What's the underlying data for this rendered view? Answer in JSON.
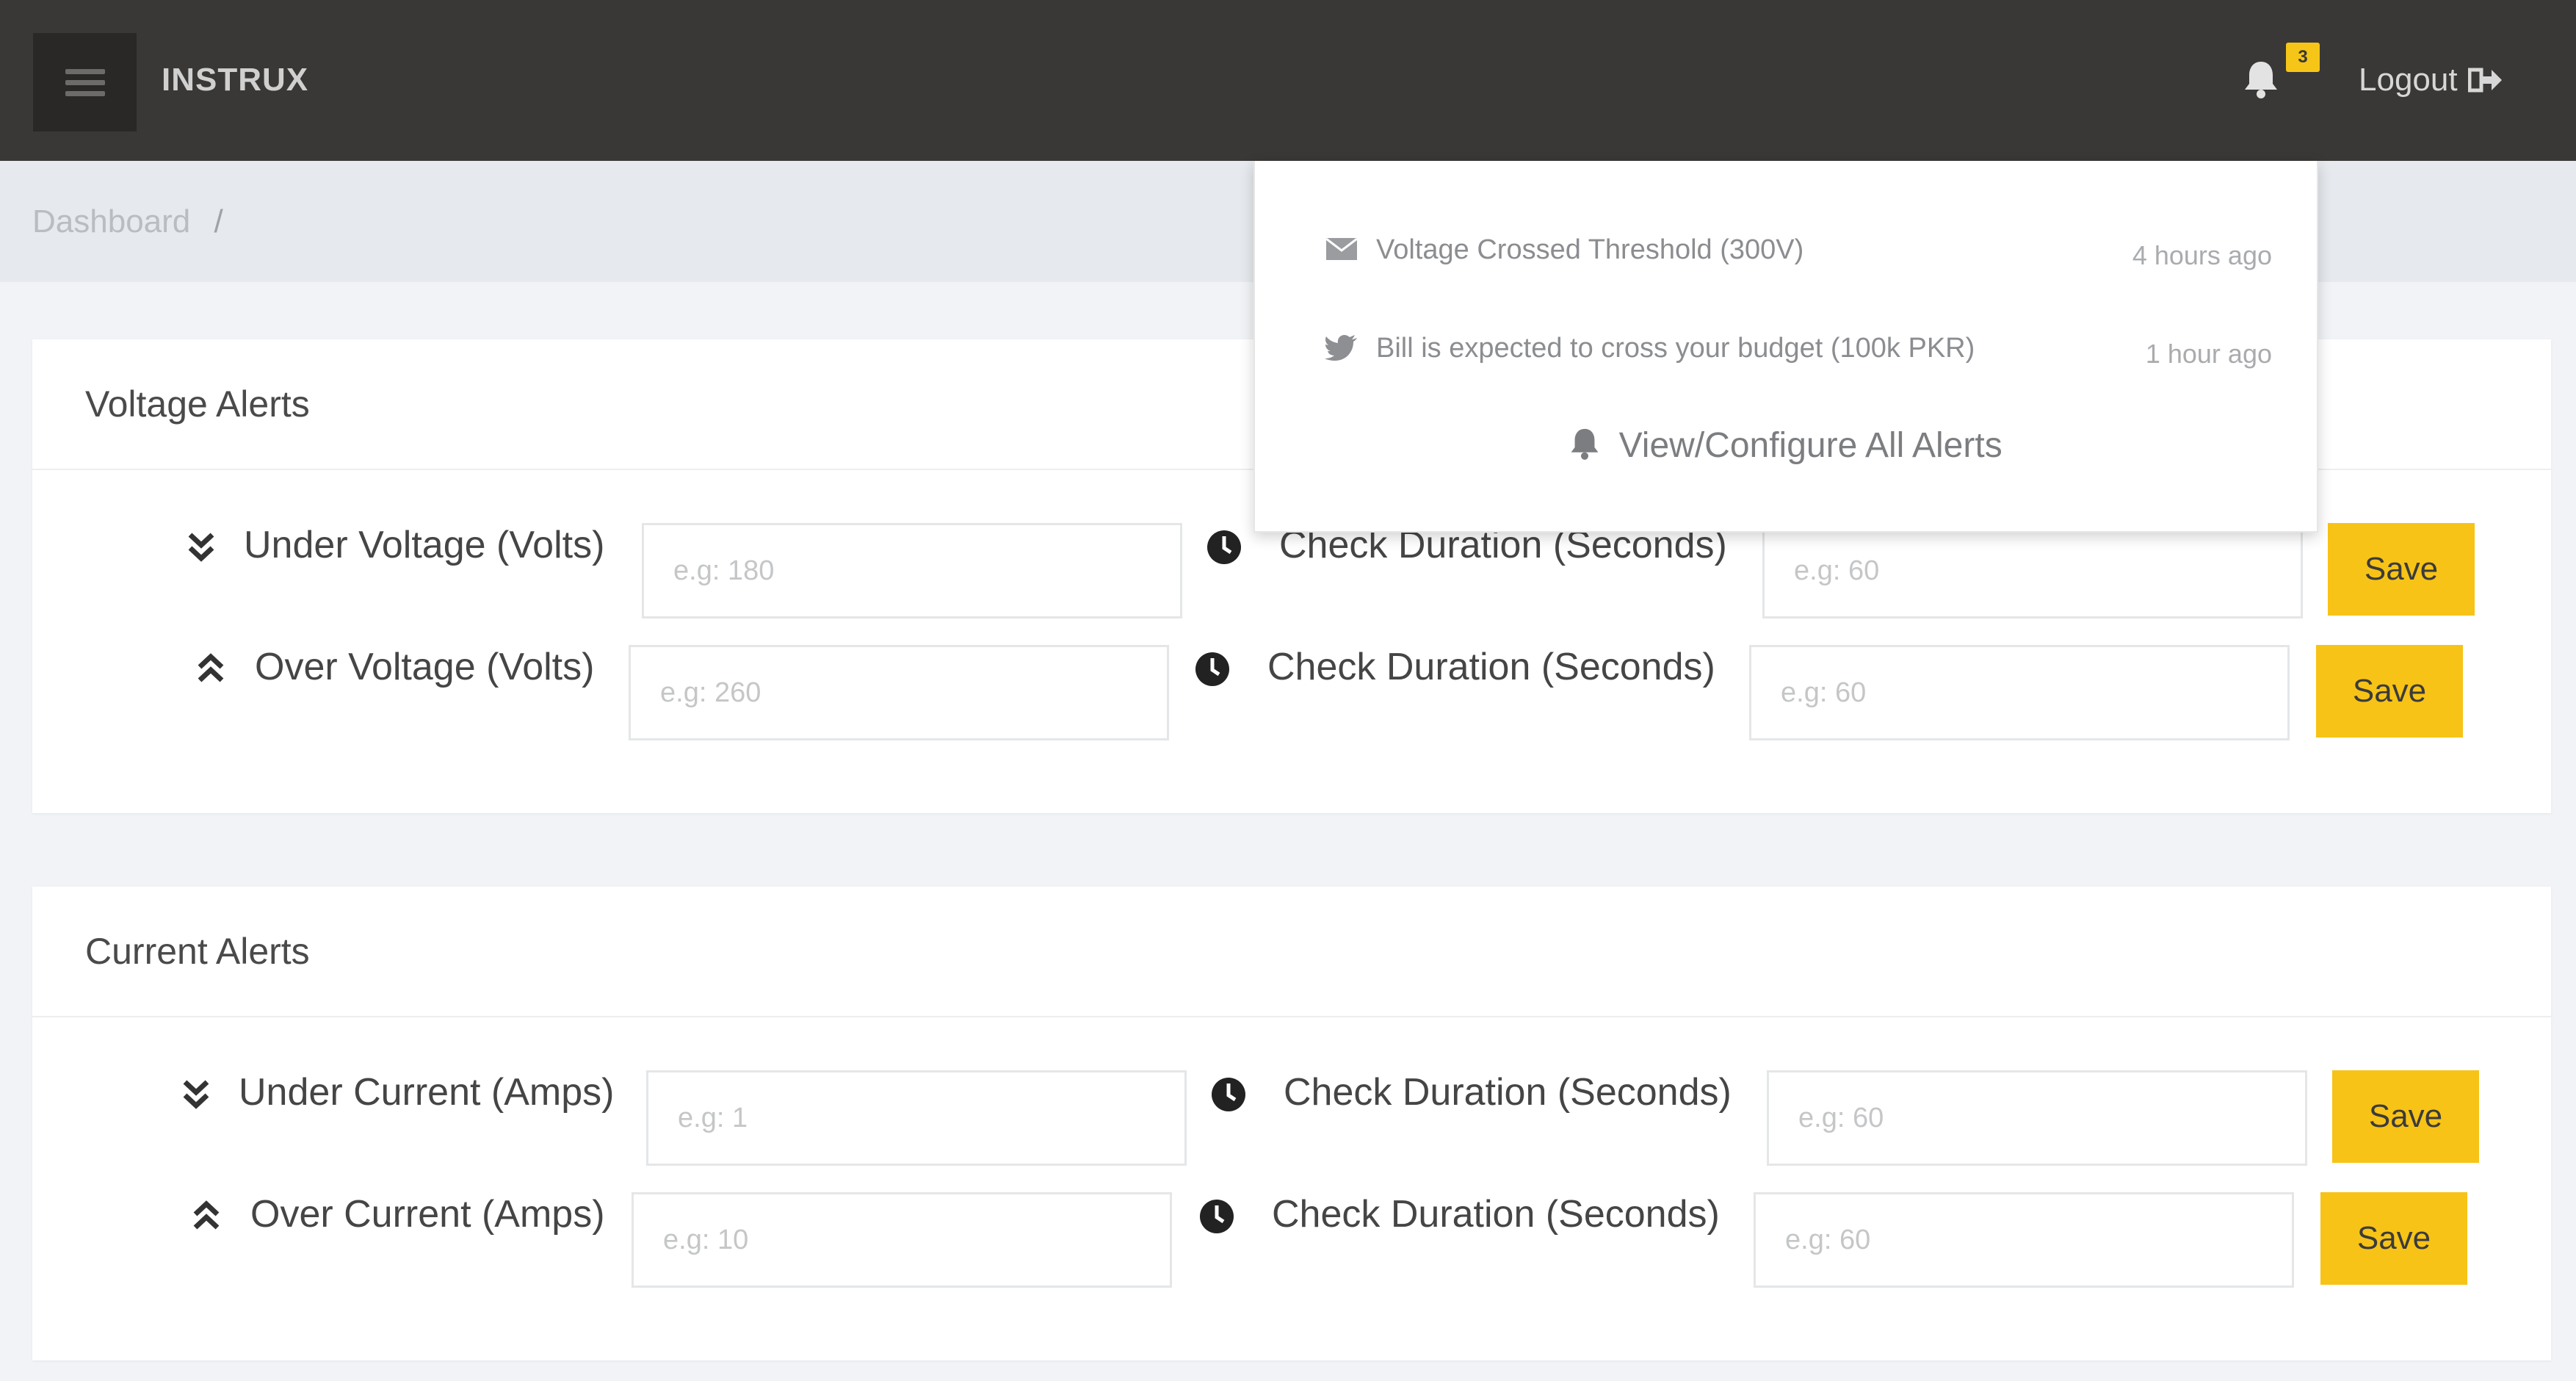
{
  "colors": {
    "topbar": "#3a3836",
    "accent": "#f7c316",
    "background": "#f1f3f6"
  },
  "app": {
    "brand": "INSTRUX"
  },
  "topbar": {
    "menu_icon": "hamburger-icon",
    "bell_icon": "bell-icon",
    "notification_count": "3",
    "logout_label": "Logout",
    "logout_icon": "sign-out-icon"
  },
  "breadcrumb": {
    "items": [
      "Dashboard"
    ],
    "separator": "/"
  },
  "notifications": {
    "items": [
      {
        "icon": "envelope-icon",
        "text": "Voltage Crossed Threshold (300V)",
        "time": "4 hours ago"
      },
      {
        "icon": "twitter-icon",
        "text": "Bill is expected to cross your budget (100k PKR)",
        "time": "1 hour ago"
      }
    ],
    "view_all_label": "View/Configure All Alerts"
  },
  "voltage": {
    "title": "Voltage Alerts",
    "under": {
      "icon": "double-chevron-down-icon",
      "label": "Under Voltage (Volts)",
      "placeholder": "e.g: 180",
      "duration_label": "Check Duration (Seconds)",
      "duration_placeholder": "e.g: 60",
      "save_label": "Save"
    },
    "over": {
      "icon": "double-chevron-up-icon",
      "label": "Over Voltage (Volts)",
      "placeholder": "e.g: 260",
      "duration_label": "Check Duration (Seconds)",
      "duration_placeholder": "e.g: 60",
      "save_label": "Save"
    }
  },
  "current": {
    "title": "Current Alerts",
    "under": {
      "icon": "double-chevron-down-icon",
      "label": "Under Current (Amps)",
      "placeholder": "e.g: 1",
      "duration_label": "Check Duration (Seconds)",
      "duration_placeholder": "e.g: 60",
      "save_label": "Save"
    },
    "over": {
      "icon": "double-chevron-up-icon",
      "label": "Over Current (Amps)",
      "placeholder": "e.g: 10",
      "duration_label": "Check Duration (Seconds)",
      "duration_placeholder": "e.g: 60",
      "save_label": "Save"
    }
  }
}
